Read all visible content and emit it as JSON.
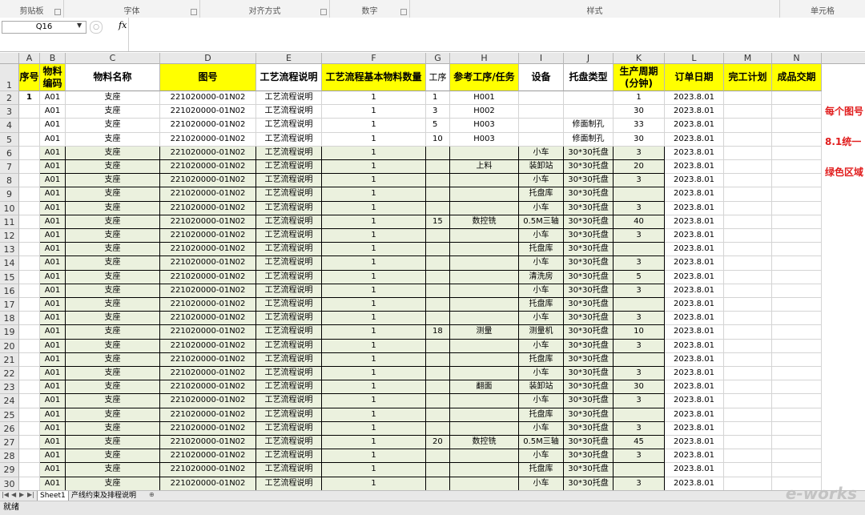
{
  "ribbon": {
    "groups": [
      {
        "label": "剪贴板"
      },
      {
        "label": "字体"
      },
      {
        "label": "对齐方式"
      },
      {
        "label": "数字"
      },
      {
        "label": "样式"
      },
      {
        "label": "单元格"
      }
    ]
  },
  "formula_bar": {
    "cell_ref": "Q16",
    "fx": "fx"
  },
  "columns": [
    "A",
    "B",
    "C",
    "D",
    "E",
    "F",
    "G",
    "H",
    "I",
    "J",
    "K",
    "L",
    "M",
    "N"
  ],
  "header": {
    "A": "序号",
    "B": "物料编码",
    "C": "物料名称",
    "D": "图号",
    "E": "工艺流程说明",
    "F": "工艺流程基本物料数量",
    "G": "工序",
    "H": "参考工序/任务",
    "I": "设备",
    "J": "托盘类型",
    "K": "生产周期(分钟)",
    "L": "订单日期",
    "M": "完工计划",
    "N": "成品交期"
  },
  "rows": [
    {
      "n": "2",
      "A": "1",
      "B": "A01",
      "C": "支座",
      "D": "221020000-01N02",
      "E": "工艺流程说明",
      "F": "1",
      "G": "1",
      "H": "H001",
      "I": "",
      "J": "",
      "K": "1",
      "L": "2023.8.01"
    },
    {
      "n": "3",
      "A": "",
      "B": "A01",
      "C": "支座",
      "D": "221020000-01N02",
      "E": "工艺流程说明",
      "F": "1",
      "G": "3",
      "H": "H002",
      "I": "",
      "J": "",
      "K": "30",
      "L": "2023.8.01"
    },
    {
      "n": "4",
      "A": "",
      "B": "A01",
      "C": "支座",
      "D": "221020000-01N02",
      "E": "工艺流程说明",
      "F": "1",
      "G": "5",
      "H": "H003",
      "I": "",
      "J": "修面制孔",
      "K": "33",
      "L": "2023.8.01"
    },
    {
      "n": "5",
      "A": "",
      "B": "A01",
      "C": "支座",
      "D": "221020000-01N02",
      "E": "工艺流程说明",
      "F": "1",
      "G": "10",
      "H": "H003",
      "I": "",
      "J": "修面制孔",
      "K": "30",
      "L": "2023.8.01"
    },
    {
      "n": "6",
      "A": "",
      "B": "A01",
      "C": "支座",
      "D": "221020000-01N02",
      "E": "工艺流程说明",
      "F": "1",
      "G": "",
      "H": "",
      "I": "小车",
      "J": "30*30托盘",
      "K": "3",
      "L": "2023.8.01"
    },
    {
      "n": "7",
      "A": "",
      "B": "A01",
      "C": "支座",
      "D": "221020000-01N02",
      "E": "工艺流程说明",
      "F": "1",
      "G": "",
      "H": "上料",
      "I": "装卸站",
      "J": "30*30托盘",
      "K": "20",
      "L": "2023.8.01"
    },
    {
      "n": "8",
      "A": "",
      "B": "A01",
      "C": "支座",
      "D": "221020000-01N02",
      "E": "工艺流程说明",
      "F": "1",
      "G": "",
      "H": "",
      "I": "小车",
      "J": "30*30托盘",
      "K": "3",
      "L": "2023.8.01"
    },
    {
      "n": "9",
      "A": "",
      "B": "A01",
      "C": "支座",
      "D": "221020000-01N02",
      "E": "工艺流程说明",
      "F": "1",
      "G": "",
      "H": "",
      "I": "托盘库",
      "J": "30*30托盘",
      "K": "",
      "L": "2023.8.01"
    },
    {
      "n": "10",
      "A": "",
      "B": "A01",
      "C": "支座",
      "D": "221020000-01N02",
      "E": "工艺流程说明",
      "F": "1",
      "G": "",
      "H": "",
      "I": "小车",
      "J": "30*30托盘",
      "K": "3",
      "L": "2023.8.01"
    },
    {
      "n": "11",
      "A": "",
      "B": "A01",
      "C": "支座",
      "D": "221020000-01N02",
      "E": "工艺流程说明",
      "F": "1",
      "G": "15",
      "H": "数控铣",
      "I": "0.5M三轴",
      "J": "30*30托盘",
      "K": "40",
      "L": "2023.8.01"
    },
    {
      "n": "12",
      "A": "",
      "B": "A01",
      "C": "支座",
      "D": "221020000-01N02",
      "E": "工艺流程说明",
      "F": "1",
      "G": "",
      "H": "",
      "I": "小车",
      "J": "30*30托盘",
      "K": "3",
      "L": "2023.8.01"
    },
    {
      "n": "13",
      "A": "",
      "B": "A01",
      "C": "支座",
      "D": "221020000-01N02",
      "E": "工艺流程说明",
      "F": "1",
      "G": "",
      "H": "",
      "I": "托盘库",
      "J": "30*30托盘",
      "K": "",
      "L": "2023.8.01"
    },
    {
      "n": "14",
      "A": "",
      "B": "A01",
      "C": "支座",
      "D": "221020000-01N02",
      "E": "工艺流程说明",
      "F": "1",
      "G": "",
      "H": "",
      "I": "小车",
      "J": "30*30托盘",
      "K": "3",
      "L": "2023.8.01"
    },
    {
      "n": "15",
      "A": "",
      "B": "A01",
      "C": "支座",
      "D": "221020000-01N02",
      "E": "工艺流程说明",
      "F": "1",
      "G": "",
      "H": "",
      "I": "清洗房",
      "J": "30*30托盘",
      "K": "5",
      "L": "2023.8.01"
    },
    {
      "n": "16",
      "A": "",
      "B": "A01",
      "C": "支座",
      "D": "221020000-01N02",
      "E": "工艺流程说明",
      "F": "1",
      "G": "",
      "H": "",
      "I": "小车",
      "J": "30*30托盘",
      "K": "3",
      "L": "2023.8.01"
    },
    {
      "n": "17",
      "A": "",
      "B": "A01",
      "C": "支座",
      "D": "221020000-01N02",
      "E": "工艺流程说明",
      "F": "1",
      "G": "",
      "H": "",
      "I": "托盘库",
      "J": "30*30托盘",
      "K": "",
      "L": "2023.8.01"
    },
    {
      "n": "18",
      "A": "",
      "B": "A01",
      "C": "支座",
      "D": "221020000-01N02",
      "E": "工艺流程说明",
      "F": "1",
      "G": "",
      "H": "",
      "I": "小车",
      "J": "30*30托盘",
      "K": "3",
      "L": "2023.8.01"
    },
    {
      "n": "19",
      "A": "",
      "B": "A01",
      "C": "支座",
      "D": "221020000-01N02",
      "E": "工艺流程说明",
      "F": "1",
      "G": "18",
      "H": "测量",
      "I": "测量机",
      "J": "30*30托盘",
      "K": "10",
      "L": "2023.8.01"
    },
    {
      "n": "20",
      "A": "",
      "B": "A01",
      "C": "支座",
      "D": "221020000-01N02",
      "E": "工艺流程说明",
      "F": "1",
      "G": "",
      "H": "",
      "I": "小车",
      "J": "30*30托盘",
      "K": "3",
      "L": "2023.8.01"
    },
    {
      "n": "21",
      "A": "",
      "B": "A01",
      "C": "支座",
      "D": "221020000-01N02",
      "E": "工艺流程说明",
      "F": "1",
      "G": "",
      "H": "",
      "I": "托盘库",
      "J": "30*30托盘",
      "K": "",
      "L": "2023.8.01"
    },
    {
      "n": "22",
      "A": "",
      "B": "A01",
      "C": "支座",
      "D": "221020000-01N02",
      "E": "工艺流程说明",
      "F": "1",
      "G": "",
      "H": "",
      "I": "小车",
      "J": "30*30托盘",
      "K": "3",
      "L": "2023.8.01"
    },
    {
      "n": "23",
      "A": "",
      "B": "A01",
      "C": "支座",
      "D": "221020000-01N02",
      "E": "工艺流程说明",
      "F": "1",
      "G": "",
      "H": "翻面",
      "I": "装卸站",
      "J": "30*30托盘",
      "K": "30",
      "L": "2023.8.01"
    },
    {
      "n": "24",
      "A": "",
      "B": "A01",
      "C": "支座",
      "D": "221020000-01N02",
      "E": "工艺流程说明",
      "F": "1",
      "G": "",
      "H": "",
      "I": "小车",
      "J": "30*30托盘",
      "K": "3",
      "L": "2023.8.01"
    },
    {
      "n": "25",
      "A": "",
      "B": "A01",
      "C": "支座",
      "D": "221020000-01N02",
      "E": "工艺流程说明",
      "F": "1",
      "G": "",
      "H": "",
      "I": "托盘库",
      "J": "30*30托盘",
      "K": "",
      "L": "2023.8.01"
    },
    {
      "n": "26",
      "A": "",
      "B": "A01",
      "C": "支座",
      "D": "221020000-01N02",
      "E": "工艺流程说明",
      "F": "1",
      "G": "",
      "H": "",
      "I": "小车",
      "J": "30*30托盘",
      "K": "3",
      "L": "2023.8.01"
    },
    {
      "n": "27",
      "A": "",
      "B": "A01",
      "C": "支座",
      "D": "221020000-01N02",
      "E": "工艺流程说明",
      "F": "1",
      "G": "20",
      "H": "数控铣",
      "I": "0.5M三轴",
      "J": "30*30托盘",
      "K": "45",
      "L": "2023.8.01"
    },
    {
      "n": "28",
      "A": "",
      "B": "A01",
      "C": "支座",
      "D": "221020000-01N02",
      "E": "工艺流程说明",
      "F": "1",
      "G": "",
      "H": "",
      "I": "小车",
      "J": "30*30托盘",
      "K": "3",
      "L": "2023.8.01"
    },
    {
      "n": "29",
      "A": "",
      "B": "A01",
      "C": "支座",
      "D": "221020000-01N02",
      "E": "工艺流程说明",
      "F": "1",
      "G": "",
      "H": "",
      "I": "托盘库",
      "J": "30*30托盘",
      "K": "",
      "L": "2023.8.01"
    },
    {
      "n": "30",
      "A": "",
      "B": "A01",
      "C": "支座",
      "D": "221020000-01N02",
      "E": "工艺流程说明",
      "F": "1",
      "G": "",
      "H": "",
      "I": "小车",
      "J": "30*30托盘",
      "K": "3",
      "L": "2023.8.01"
    }
  ],
  "notes": [
    "每个图号",
    "8.1统一",
    "绿色区域"
  ],
  "sheet_tabs": [
    "Sheet1",
    "产线约束及排程说明"
  ],
  "status": {
    "ready": "就绪"
  },
  "watermark": "e-works",
  "colors": {
    "header_yellow": "#ffff00",
    "green_fill": "#ebf1de",
    "note_red": "#e11d1d"
  }
}
